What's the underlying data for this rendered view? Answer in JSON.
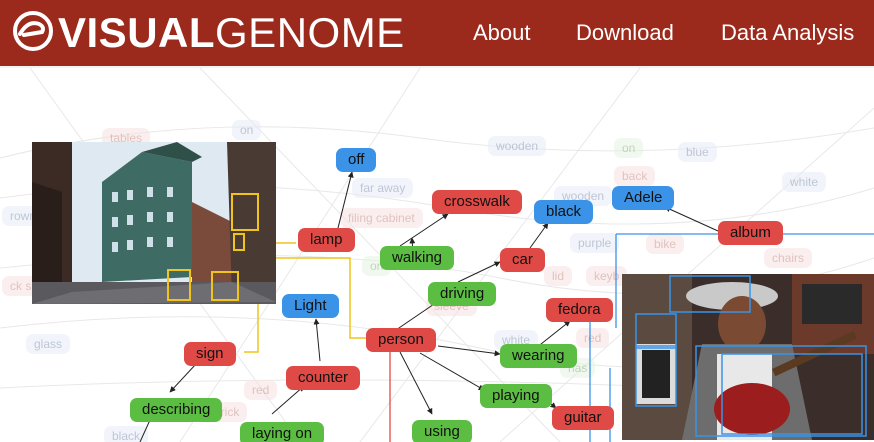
{
  "header": {
    "logo_bold": "VISUAL",
    "logo_light": "GENOME",
    "nav": [
      "About",
      "Download",
      "Data Analysis"
    ]
  },
  "colors": {
    "header_bg": "#9b2a1c",
    "object_node": "#e04a46",
    "attribute_node": "#3b93e8",
    "relationship_node": "#5bbd41"
  },
  "background_labels": [
    {
      "text": "tables",
      "c": "r"
    },
    {
      "text": "on",
      "c": "b"
    },
    {
      "text": "wooden",
      "c": "b"
    },
    {
      "text": "on",
      "c": "g"
    },
    {
      "text": "blue",
      "c": "b"
    },
    {
      "text": "back",
      "c": "r"
    },
    {
      "text": "white",
      "c": "b"
    },
    {
      "text": "far away",
      "c": "b"
    },
    {
      "text": "wooden",
      "c": "b"
    },
    {
      "text": "filing cabinet",
      "c": "r"
    },
    {
      "text": "rown",
      "c": "b"
    },
    {
      "text": "purple",
      "c": "b"
    },
    {
      "text": "bike",
      "c": "r"
    },
    {
      "text": "chairs",
      "c": "r"
    },
    {
      "text": "on",
      "c": "g"
    },
    {
      "text": "lid",
      "c": "r"
    },
    {
      "text": "keyb",
      "c": "r"
    },
    {
      "text": "ck sig",
      "c": "r"
    },
    {
      "text": "sleeve",
      "c": "r"
    },
    {
      "text": "glass",
      "c": "b"
    },
    {
      "text": "white",
      "c": "b"
    },
    {
      "text": "red",
      "c": "r"
    },
    {
      "text": "has",
      "c": "g"
    },
    {
      "text": "red",
      "c": "r"
    },
    {
      "text": "brick",
      "c": "r"
    },
    {
      "text": "black",
      "c": "b"
    }
  ],
  "graph": {
    "nodes": [
      {
        "id": "off",
        "label": "off",
        "type": "attribute"
      },
      {
        "id": "crosswalk",
        "label": "crosswalk",
        "type": "object"
      },
      {
        "id": "black",
        "label": "black",
        "type": "attribute"
      },
      {
        "id": "adele",
        "label": "Adele",
        "type": "attribute"
      },
      {
        "id": "lamp",
        "label": "lamp",
        "type": "object"
      },
      {
        "id": "album",
        "label": "album",
        "type": "object"
      },
      {
        "id": "walking",
        "label": "walking",
        "type": "relationship"
      },
      {
        "id": "car",
        "label": "car",
        "type": "object"
      },
      {
        "id": "driving",
        "label": "driving",
        "type": "relationship"
      },
      {
        "id": "light",
        "label": "Light",
        "type": "attribute"
      },
      {
        "id": "fedora",
        "label": "fedora",
        "type": "object"
      },
      {
        "id": "person",
        "label": "person",
        "type": "object"
      },
      {
        "id": "sign",
        "label": "sign",
        "type": "object"
      },
      {
        "id": "wearing",
        "label": "wearing",
        "type": "relationship"
      },
      {
        "id": "counter",
        "label": "counter",
        "type": "object"
      },
      {
        "id": "playing",
        "label": "playing",
        "type": "relationship"
      },
      {
        "id": "describing",
        "label": "describing",
        "type": "relationship"
      },
      {
        "id": "guitar",
        "label": "guitar",
        "type": "object"
      },
      {
        "id": "laying_on",
        "label": "laying on",
        "type": "relationship"
      },
      {
        "id": "using",
        "label": "using",
        "type": "relationship"
      }
    ]
  },
  "photos": [
    {
      "id": "street",
      "description_icon": "street-photo"
    },
    {
      "id": "guitarist",
      "description_icon": "guitarist-photo"
    }
  ]
}
